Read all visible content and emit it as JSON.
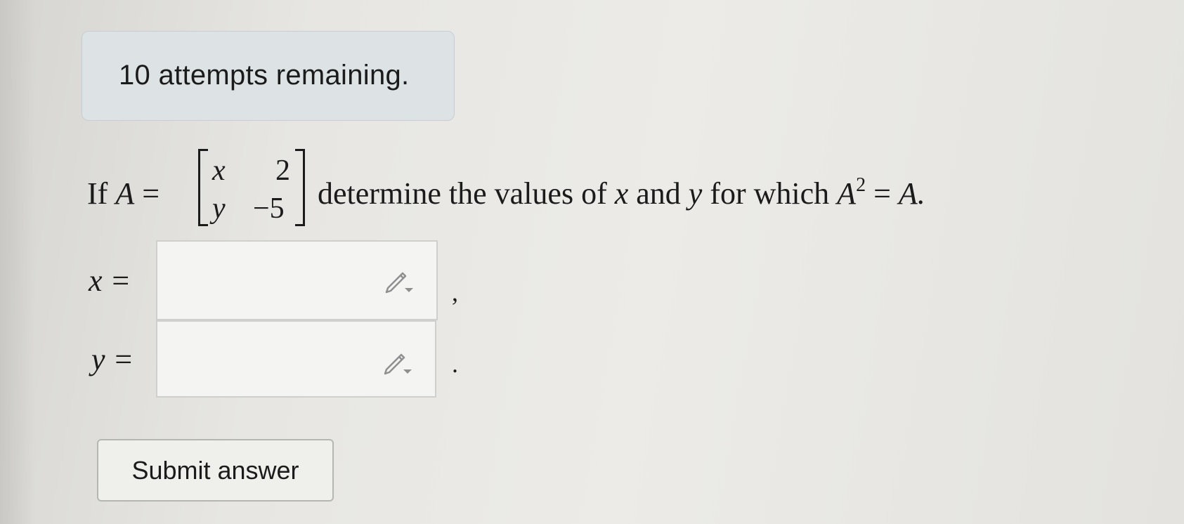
{
  "attempts_notice": "10 attempts remaining.",
  "question": {
    "prefix": "If",
    "matrix_name": "A",
    "equals": "=",
    "matrix": [
      [
        "x",
        "2"
      ],
      [
        "y",
        "−5"
      ]
    ],
    "text_mid": "determine the values of",
    "var_x": "x",
    "and_word": "and",
    "var_y": "y",
    "text_end": "for which",
    "lhs_base": "A",
    "lhs_exp": "2",
    "rhs": "A."
  },
  "answers": {
    "x_label": "x =",
    "x_value": "",
    "x_after": ",",
    "y_label": "y =",
    "y_value": "",
    "y_after": "."
  },
  "icons": {
    "math_editor": "pencil-dropdown-icon"
  },
  "submit_label": "Submit answer"
}
